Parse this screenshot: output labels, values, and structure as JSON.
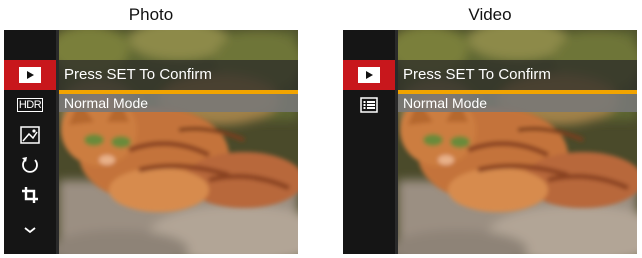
{
  "captions": {
    "photo": "Photo",
    "video": "Video"
  },
  "photo_screen": {
    "confirm_text": "Press SET To Confirm",
    "mode_text": "Normal Mode",
    "sidebar_items": [
      {
        "icon": "play-icon",
        "active": true
      },
      {
        "icon": "hdr-icon",
        "label": "HDR"
      },
      {
        "icon": "portrait-effect-icon"
      },
      {
        "icon": "rotate-icon"
      },
      {
        "icon": "crop-icon"
      },
      {
        "icon": "chevron-down-icon"
      }
    ]
  },
  "video_screen": {
    "confirm_text": "Press SET To Confirm",
    "mode_text": "Normal Mode",
    "sidebar_items": [
      {
        "icon": "play-icon",
        "active": true
      },
      {
        "icon": "list-icon"
      }
    ]
  },
  "colors": {
    "active_highlight": "#c8171c",
    "accent_line": "#f2a400",
    "sidebar_bg": "#151515"
  }
}
